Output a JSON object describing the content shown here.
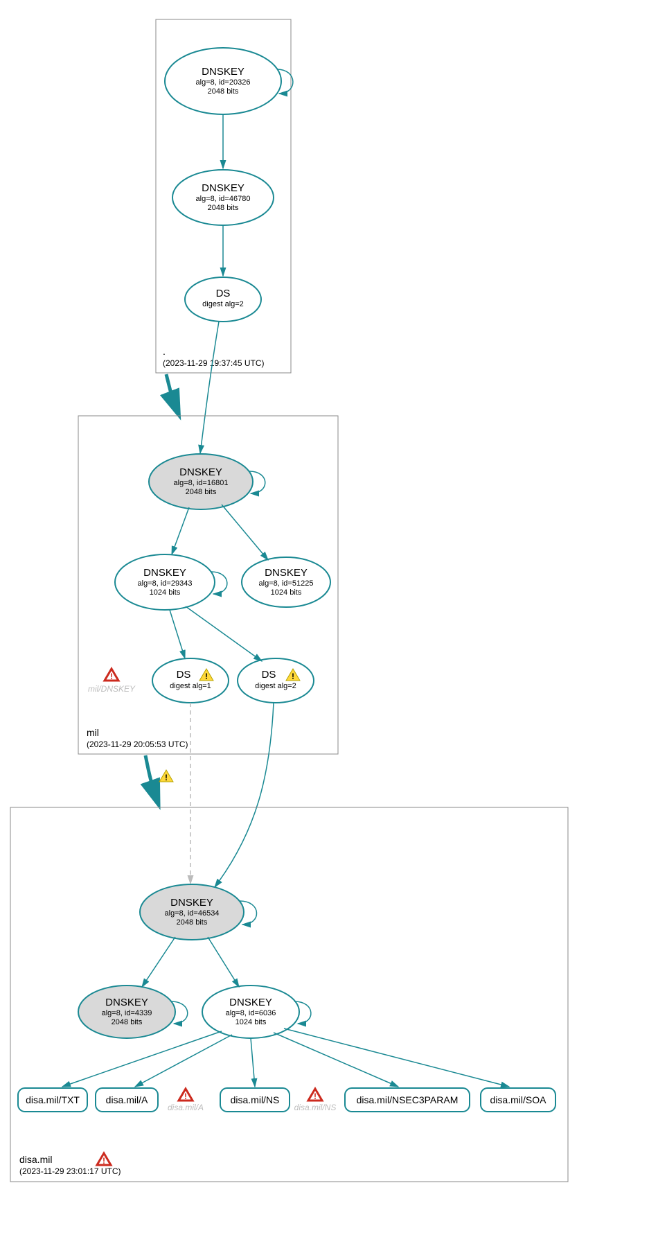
{
  "zones": {
    "root": {
      "label": ".",
      "timestamp": "(2023-11-29 19:37:45 UTC)"
    },
    "mil": {
      "label": "mil",
      "timestamp": "(2023-11-29 20:05:53 UTC)"
    },
    "disa": {
      "label": "disa.mil",
      "timestamp": "(2023-11-29 23:01:17 UTC)"
    }
  },
  "nodes": {
    "root_ksk": {
      "title": "DNSKEY",
      "line1": "alg=8, id=20326",
      "line2": "2048 bits"
    },
    "root_zsk": {
      "title": "DNSKEY",
      "line1": "alg=8, id=46780",
      "line2": "2048 bits"
    },
    "root_ds": {
      "title": "DS",
      "line1": "digest alg=2"
    },
    "mil_ksk": {
      "title": "DNSKEY",
      "line1": "alg=8, id=16801",
      "line2": "2048 bits"
    },
    "mil_zsk1": {
      "title": "DNSKEY",
      "line1": "alg=8, id=29343",
      "line2": "1024 bits"
    },
    "mil_zsk2": {
      "title": "DNSKEY",
      "line1": "alg=8, id=51225",
      "line2": "1024 bits"
    },
    "mil_ds1": {
      "title": "DS",
      "line1": "digest alg=1"
    },
    "mil_ds2": {
      "title": "DS",
      "line1": "digest alg=2"
    },
    "ghost_mil_dnskey": "mil/DNSKEY",
    "disa_ksk": {
      "title": "DNSKEY",
      "line1": "alg=8, id=46534",
      "line2": "2048 bits"
    },
    "disa_old": {
      "title": "DNSKEY",
      "line1": "alg=8, id=4339",
      "line2": "2048 bits"
    },
    "disa_zsk": {
      "title": "DNSKEY",
      "line1": "alg=8, id=6036",
      "line2": "1024 bits"
    },
    "ghost_disa_a": "disa.mil/A",
    "ghost_disa_ns": "disa.mil/NS"
  },
  "leaves": {
    "txt": "disa.mil/TXT",
    "a": "disa.mil/A",
    "ns": "disa.mil/NS",
    "nsec3": "disa.mil/NSEC3PARAM",
    "soa": "disa.mil/SOA"
  },
  "colors": {
    "teal": "#1a8993",
    "shade": "#d9d9d9"
  }
}
